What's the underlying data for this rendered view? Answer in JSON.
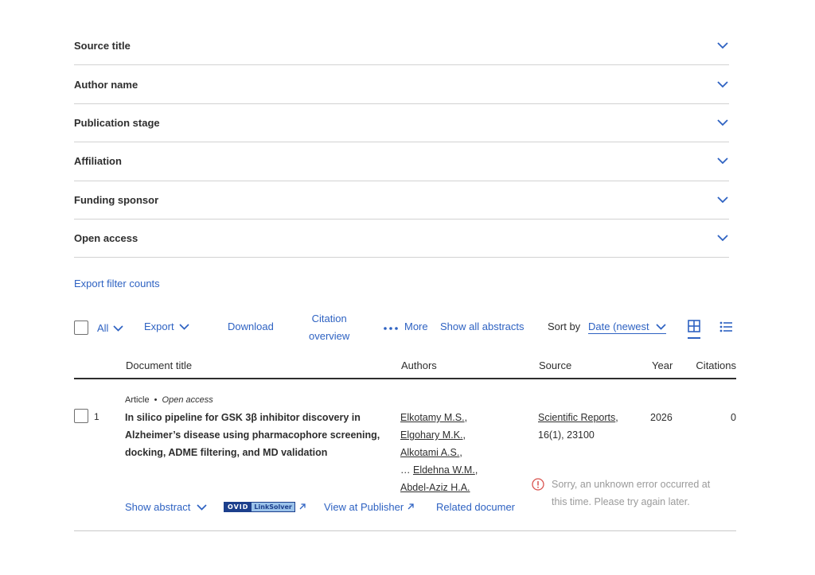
{
  "filters": [
    {
      "label": "Source title"
    },
    {
      "label": "Author name"
    },
    {
      "label": "Publication stage"
    },
    {
      "label": "Affiliation"
    },
    {
      "label": "Funding sponsor"
    },
    {
      "label": "Open access"
    }
  ],
  "export_filter_counts": "Export filter counts",
  "toolbar": {
    "all_label": "All",
    "export_label": "Export",
    "download_label": "Download",
    "citation_line1": "Citation",
    "citation_line2": "overview",
    "more_label": "More",
    "show_all_abstracts": "Show all abstracts",
    "sort_by_label": "Sort by",
    "sort_value": "Date (newest"
  },
  "table": {
    "columns": [
      "Document title",
      "Authors",
      "Source",
      "Year",
      "Citations"
    ]
  },
  "result": {
    "number": "1",
    "doc_type": "Article",
    "separator": "•",
    "access": "Open access",
    "title_lines": [
      "In silico pipeline for GSK 3β inhibitor discovery in",
      "Alzheimer’s disease using pharmacophore screening,",
      "docking, ADME filtering, and MD validation"
    ],
    "authors": [
      "Elkotamy M.S.",
      "Elgohary M.K.",
      "Alkotami A.S.",
      "Eldehna W.M.",
      "Abdel-Aziz H.A."
    ],
    "ellipsis": "…",
    "source_name": "Scientific Reports",
    "source_detail": "16(1), 23100",
    "year": "2026",
    "citations": "0",
    "error_line1": "Sorry, an unknown error occurred at",
    "error_line2": "this time. Please try again later.",
    "actions": {
      "show_abstract": "Show abstract",
      "linksolver_ovid": "OVID",
      "linksolver_text": "LinkSolver",
      "view_at_publisher": "View at Publisher",
      "related_documents": "Related documer"
    }
  },
  "colors": {
    "link": "#2e62c2",
    "text": "#2e2e2e",
    "divider": "#d2d2d2",
    "error_icon": "#d9534f"
  }
}
